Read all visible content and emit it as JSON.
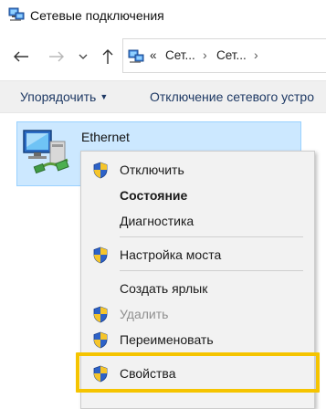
{
  "window": {
    "title": "Сетевые подключения"
  },
  "nav": {
    "back_label": "←",
    "forward_label": "→",
    "dropdown_label": "⌄",
    "up_label": "↑"
  },
  "address": {
    "overflow": "«",
    "crumb1": "Сет...",
    "crumb2": "Сет...",
    "sep": "›"
  },
  "commands": {
    "organize": "Упорядочить",
    "disable": "Отключение сетевого устро"
  },
  "item": {
    "name": "Ethernet"
  },
  "menu": {
    "items": [
      {
        "label": "Отключить",
        "shield": true,
        "bold": false,
        "disabled": false
      },
      {
        "label": "Состояние",
        "shield": false,
        "bold": true,
        "disabled": false
      },
      {
        "label": "Диагностика",
        "shield": false,
        "bold": false,
        "disabled": false
      },
      {
        "label": "Настройка моста",
        "shield": true,
        "bold": false,
        "disabled": false
      },
      {
        "label": "Создать ярлык",
        "shield": false,
        "bold": false,
        "disabled": false
      },
      {
        "label": "Удалить",
        "shield": true,
        "bold": false,
        "disabled": true
      },
      {
        "label": "Переименовать",
        "shield": true,
        "bold": false,
        "disabled": false
      },
      {
        "label": "Свойства",
        "shield": true,
        "bold": false,
        "disabled": false
      }
    ]
  },
  "colors": {
    "selection_bg": "#cce8ff",
    "highlight_border": "#f5c400",
    "command_text": "#1e3964"
  }
}
